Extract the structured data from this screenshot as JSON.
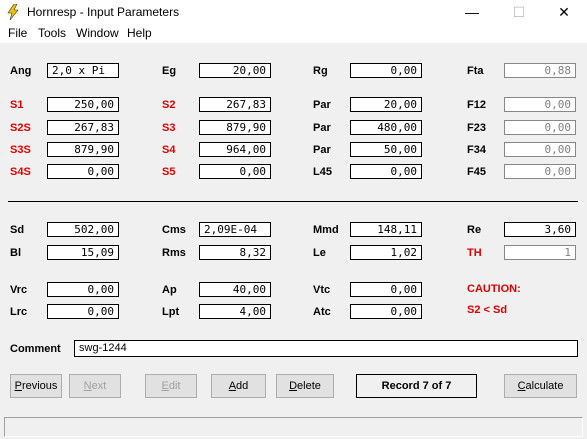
{
  "window": {
    "title": "Hornresp - Input Parameters",
    "minimize": "—",
    "maximize": "☐",
    "close": "✕"
  },
  "menu": [
    "File",
    "Tools",
    "Window",
    "Help"
  ],
  "rows1": [
    [
      {
        "label": "Ang",
        "red": false,
        "value": "2,0 x Pi",
        "left": true
      },
      {
        "label": "Eg",
        "red": false,
        "value": "20,00"
      },
      {
        "label": "Rg",
        "red": false,
        "value": "0,00"
      },
      {
        "label": "Fta",
        "red": false,
        "value": "0,88",
        "ro": true
      }
    ],
    [
      {
        "label": "S1",
        "red": true,
        "value": "250,00"
      },
      {
        "label": "S2",
        "red": true,
        "value": "267,83"
      },
      {
        "label": "Par",
        "red": false,
        "value": "20,00"
      },
      {
        "label": "F12",
        "red": false,
        "value": "0,00",
        "ro": true
      }
    ],
    [
      {
        "label": "S2S",
        "red": true,
        "value": "267,83"
      },
      {
        "label": "S3",
        "red": true,
        "value": "879,90"
      },
      {
        "label": "Par",
        "red": false,
        "value": "480,00"
      },
      {
        "label": "F23",
        "red": false,
        "value": "0,00",
        "ro": true
      }
    ],
    [
      {
        "label": "S3S",
        "red": true,
        "value": "879,90"
      },
      {
        "label": "S4",
        "red": true,
        "value": "964,00"
      },
      {
        "label": "Par",
        "red": false,
        "value": "50,00"
      },
      {
        "label": "F34",
        "red": false,
        "value": "0,00",
        "ro": true
      }
    ],
    [
      {
        "label": "S4S",
        "red": true,
        "value": "0,00"
      },
      {
        "label": "S5",
        "red": true,
        "value": "0,00"
      },
      {
        "label": "L45",
        "red": false,
        "value": "0,00"
      },
      {
        "label": "F45",
        "red": false,
        "value": "0,00",
        "ro": true
      }
    ]
  ],
  "rows2": [
    [
      {
        "label": "Sd",
        "red": false,
        "value": "502,00"
      },
      {
        "label": "Cms",
        "red": false,
        "value": "2,09E-04",
        "left": true
      },
      {
        "label": "Mmd",
        "red": false,
        "value": "148,11"
      },
      {
        "label": "Re",
        "red": false,
        "value": "3,60"
      }
    ],
    [
      {
        "label": "Bl",
        "red": false,
        "value": "15,09"
      },
      {
        "label": "Rms",
        "red": false,
        "value": "8,32"
      },
      {
        "label": "Le",
        "red": false,
        "value": "1,02"
      },
      {
        "label": "TH",
        "red": true,
        "value": "1",
        "ro": true
      }
    ]
  ],
  "rows3": [
    [
      {
        "label": "Vrc",
        "red": false,
        "value": "0,00"
      },
      {
        "label": "Ap",
        "red": false,
        "value": "40,00"
      },
      {
        "label": "Vtc",
        "red": false,
        "value": "0,00"
      }
    ],
    [
      {
        "label": "Lrc",
        "red": false,
        "value": "0,00"
      },
      {
        "label": "Lpt",
        "red": false,
        "value": "4,00"
      },
      {
        "label": "Atc",
        "red": false,
        "value": "0,00"
      }
    ]
  ],
  "caution": {
    "title": "CAUTION:",
    "message": "S2 < Sd"
  },
  "comment": {
    "label": "Comment",
    "value": "swg-1244"
  },
  "buttons": {
    "previous": "Previous",
    "next": "Next",
    "edit": "Edit",
    "add": "Add",
    "delete": "Delete",
    "calculate": "Calculate"
  },
  "record": "Record 7 of 7",
  "colors": {
    "label_red": "#e00000",
    "readonly_text": "#808080"
  }
}
